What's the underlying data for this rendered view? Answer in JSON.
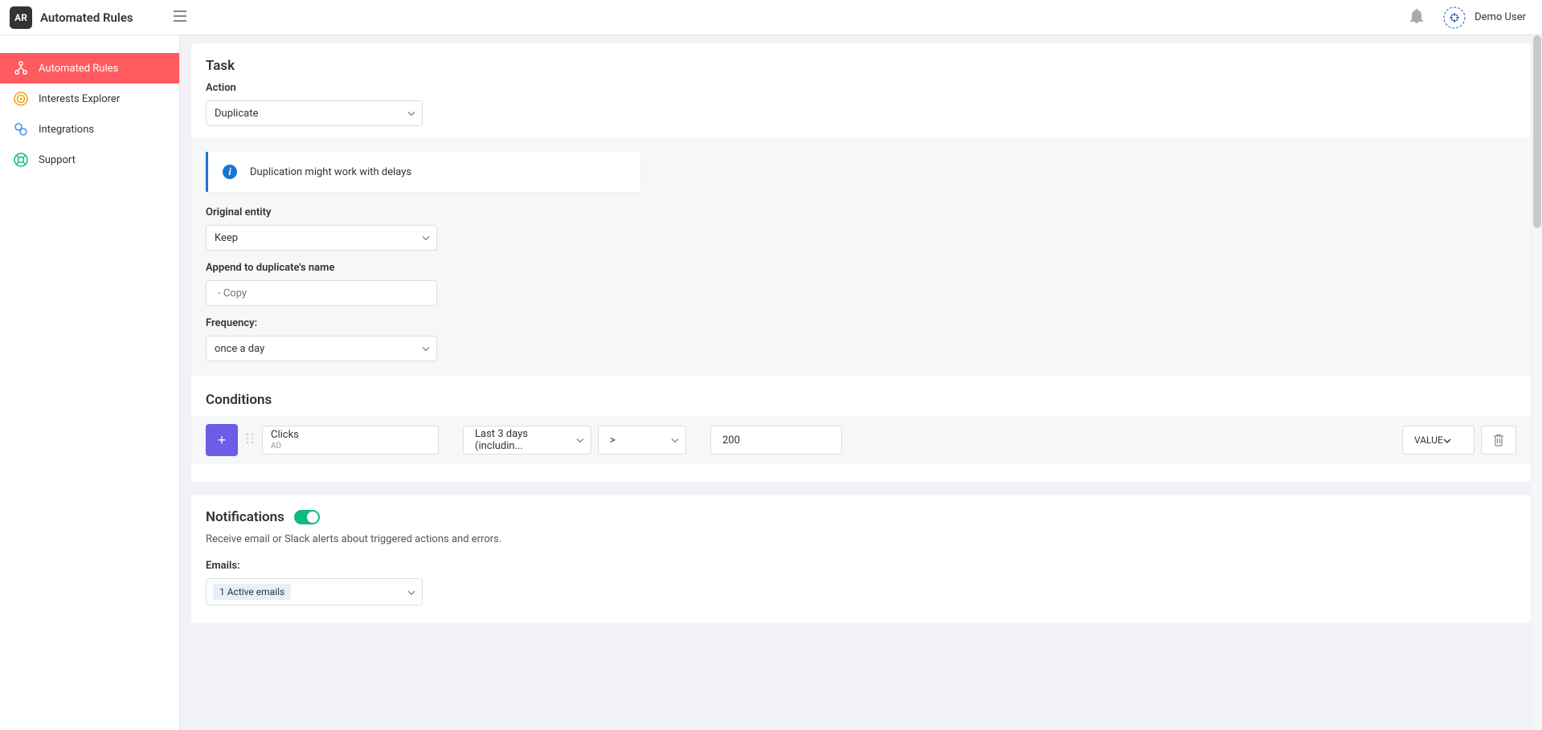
{
  "header": {
    "app_logo_text": "AR",
    "app_title": "Automated Rules",
    "user_name": "Demo User"
  },
  "sidebar": {
    "items": [
      {
        "label": "Automated Rules",
        "icon": "nodes-icon",
        "active": true,
        "color": "#fff"
      },
      {
        "label": "Interests Explorer",
        "icon": "target-icon",
        "active": false,
        "color": "#f39c12"
      },
      {
        "label": "Integrations",
        "icon": "link-icon",
        "active": false,
        "color": "#4a8ee6"
      },
      {
        "label": "Support",
        "icon": "life-ring-icon",
        "active": false,
        "color": "#10b981"
      }
    ]
  },
  "task": {
    "title": "Task",
    "action_label": "Action",
    "action_value": "Duplicate",
    "info_message": "Duplication might work with delays",
    "original_entity_label": "Original entity",
    "original_entity_value": "Keep",
    "append_label": "Append to duplicate's name",
    "append_placeholder": "- Copy",
    "frequency_label": "Frequency:",
    "frequency_value": "once a day"
  },
  "conditions": {
    "title": "Conditions",
    "row": {
      "metric_name": "Clicks",
      "metric_sub": "AD",
      "range": "Last 3 days (includin...",
      "operator": ">",
      "value": "200",
      "value_type": "VALUE"
    }
  },
  "notifications": {
    "title": "Notifications",
    "description": "Receive email or Slack alerts about triggered actions and errors.",
    "emails_label": "Emails:",
    "emails_tag": "1 Active emails"
  }
}
